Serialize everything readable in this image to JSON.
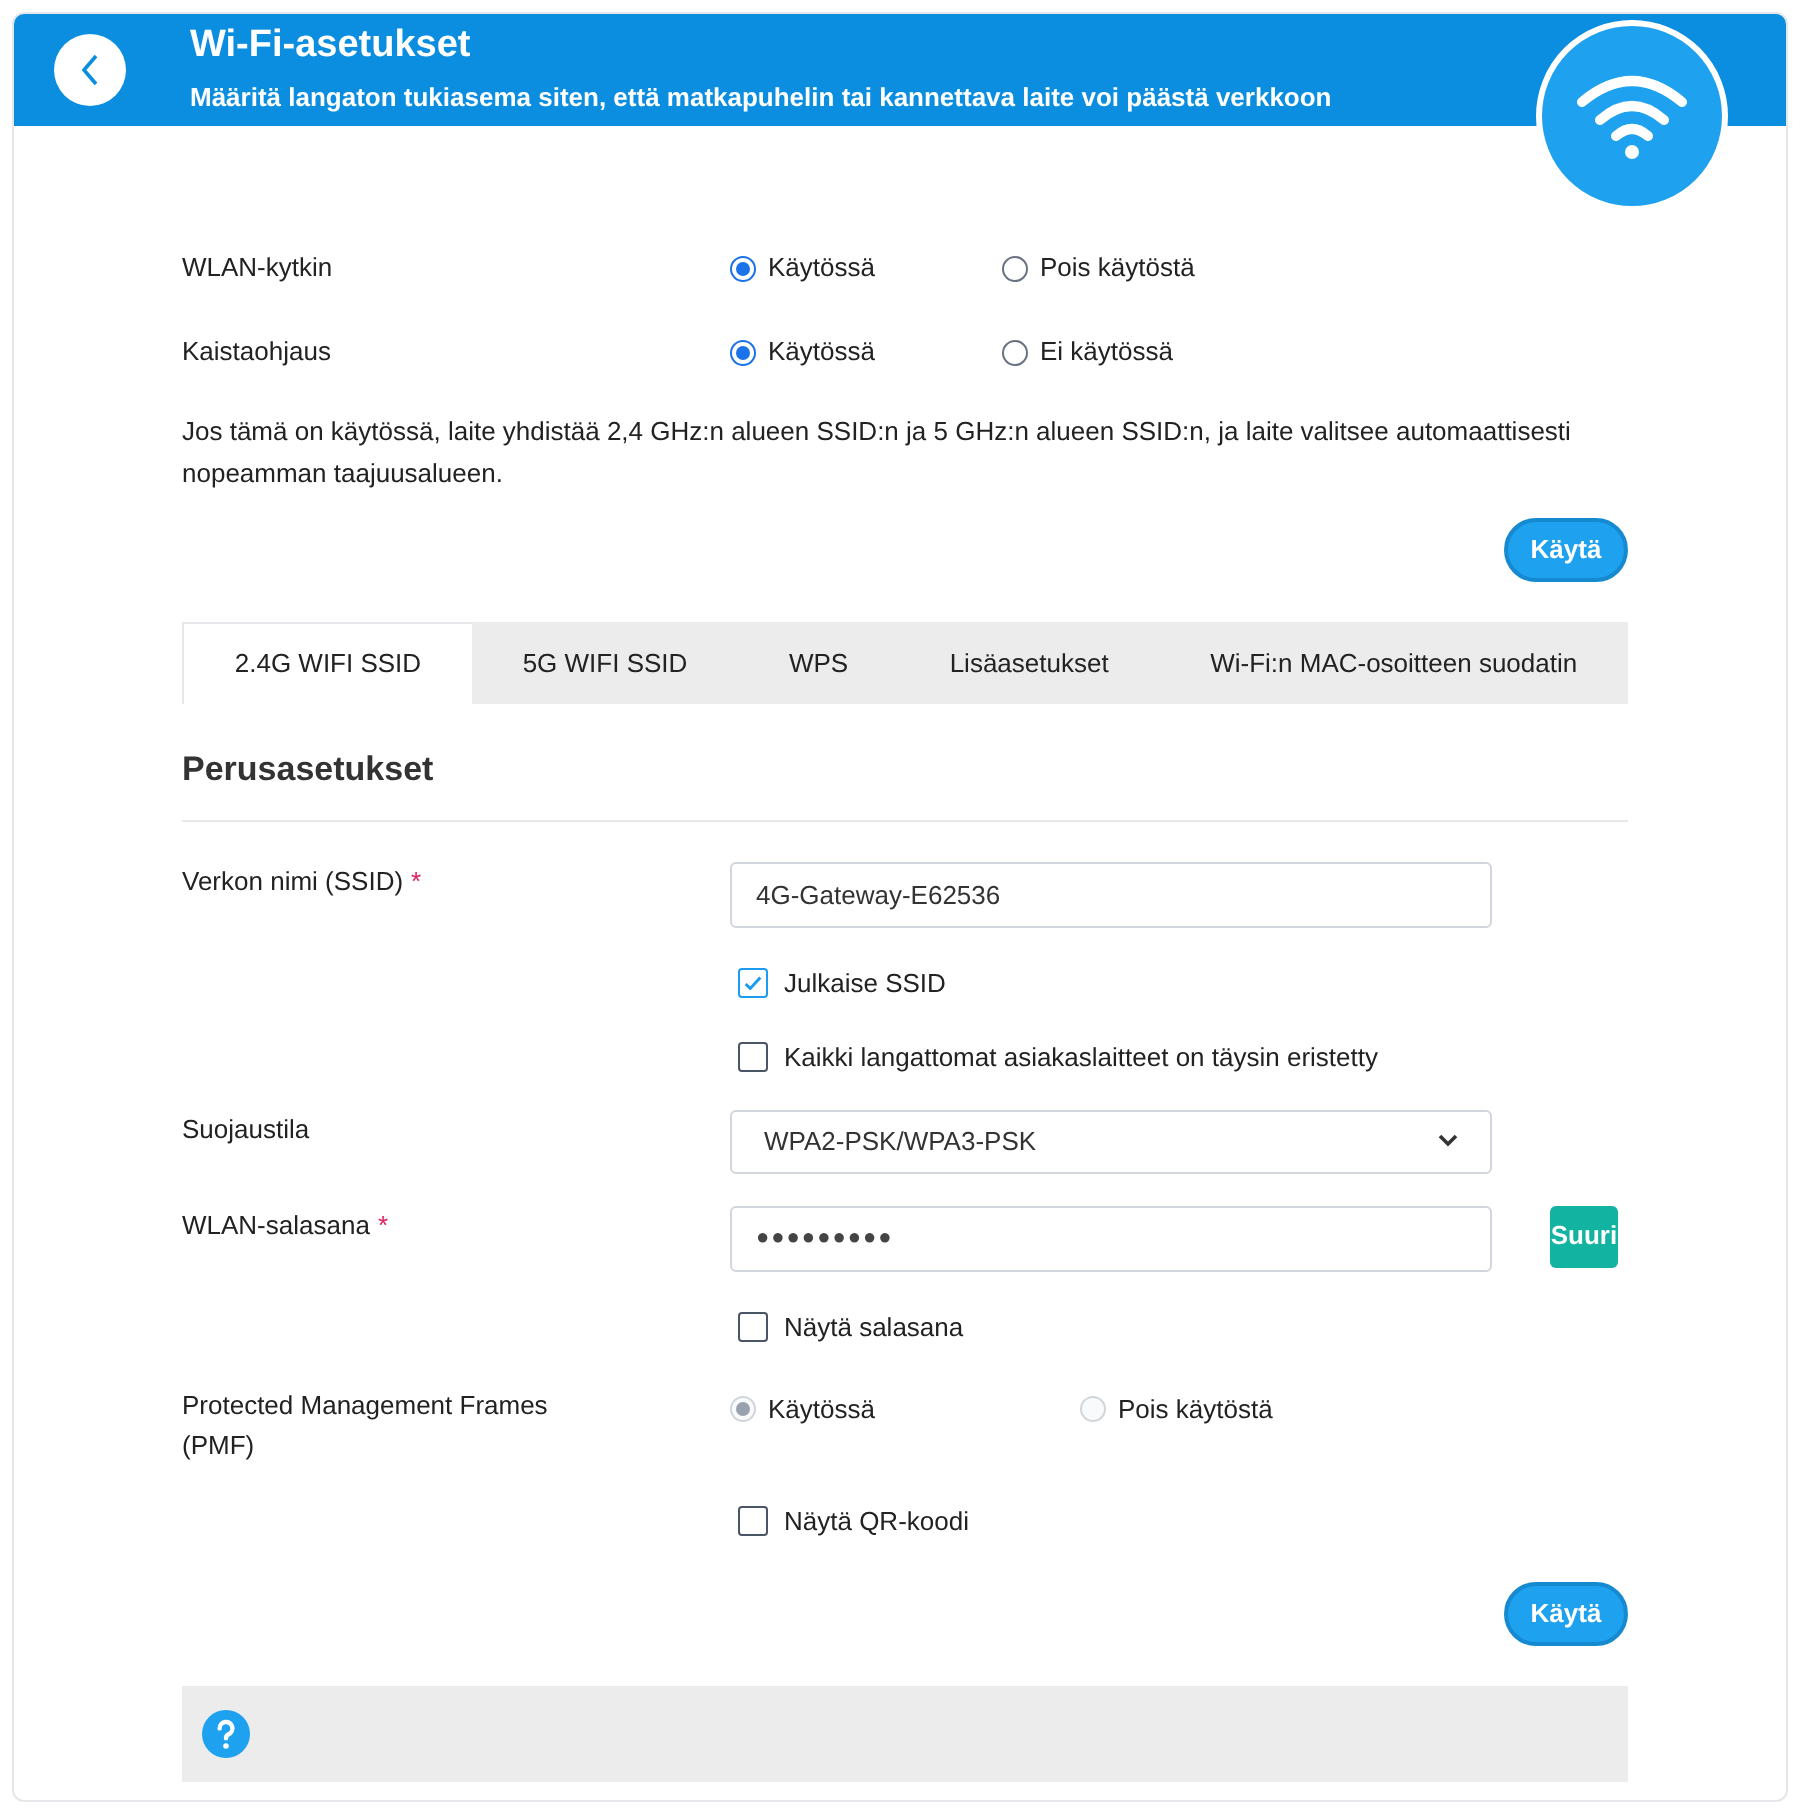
{
  "header": {
    "title": "Wi-Fi-asetukset",
    "subtitle": "Määritä langaton tukiasema siten, että matkapuhelin tai kannettava laite voi päästä verkkoon"
  },
  "radio_rows": [
    {
      "label": "WLAN-kytkin",
      "options": [
        {
          "label": "Käytössä",
          "selected": true
        },
        {
          "label": "Pois käytöstä",
          "selected": false
        }
      ]
    },
    {
      "label": "Kaistaohjaus",
      "options": [
        {
          "label": "Käytössä",
          "selected": true
        },
        {
          "label": "Ei käytössä",
          "selected": false
        }
      ]
    }
  ],
  "description": "Jos tämä on käytössä, laite yhdistää 2,4 GHz:n alueen SSID:n ja 5 GHz:n alueen SSID:n, ja laite valitsee automaattisesti nopeamman taajuusalueen.",
  "apply_button": "Käytä",
  "tabs": [
    {
      "label": "2.4G WIFI SSID",
      "selected": true
    },
    {
      "label": "5G WIFI SSID",
      "selected": false
    },
    {
      "label": "WPS",
      "selected": false
    },
    {
      "label": "Lisäasetukset",
      "selected": false
    },
    {
      "label": "Wi-Fi:n MAC-osoitteen suodatin",
      "selected": false
    }
  ],
  "section_title": "Perusasetukset",
  "form": [
    {
      "kind": "text",
      "label": "Verkon nimi (SSID)",
      "required_mark": "*",
      "value": "4G-Gateway-E62536"
    },
    {
      "kind": "checkbox",
      "label": "Julkaise SSID",
      "checked": true
    },
    {
      "kind": "checkbox",
      "label": "Kaikki langattomat asiakaslaitteet on täysin eristetty",
      "checked": false
    },
    {
      "kind": "select",
      "label": "Suojaustila",
      "value": "WPA2-PSK/WPA3-PSK"
    },
    {
      "kind": "password",
      "label": "WLAN-salasana",
      "required_mark": "*",
      "value": "●●●●●●●●●",
      "strength": "Suuri"
    },
    {
      "kind": "checkbox",
      "label": "Näytä salasana",
      "checked": false
    },
    {
      "kind": "radio",
      "label": "Protected Management Frames (PMF)",
      "disabled": true,
      "options": [
        {
          "label": "Käytössä",
          "selected": true
        },
        {
          "label": "Pois käytöstä",
          "selected": false
        }
      ]
    },
    {
      "kind": "checkbox",
      "label": "Näytä QR-koodi",
      "checked": false
    }
  ],
  "form_apply_button": "Käytä"
}
